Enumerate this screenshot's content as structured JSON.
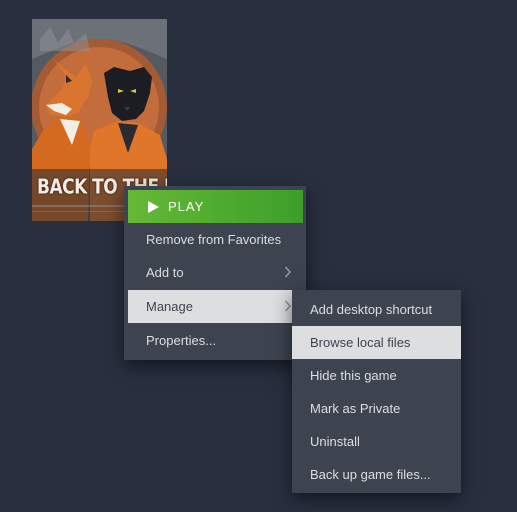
{
  "game": {
    "cover_title": "BACK TO THE DAWN",
    "cover_icon": "fox-and-panther-artwork"
  },
  "context_menu": {
    "play_label": "PLAY",
    "play_icon": "play-triangle-icon",
    "items": [
      {
        "label": "Remove from Favorites"
      },
      {
        "label": "Add to",
        "submenu": true
      },
      {
        "label": "Manage",
        "submenu": true,
        "highlighted": true
      },
      {
        "label": "Properties..."
      }
    ]
  },
  "manage_submenu": {
    "items": [
      {
        "label": "Add desktop shortcut"
      },
      {
        "label": "Browse local files",
        "highlighted": true
      },
      {
        "label": "Hide this game"
      },
      {
        "label": "Mark as Private"
      },
      {
        "label": "Uninstall"
      },
      {
        "label": "Back up game files..."
      }
    ]
  },
  "colors": {
    "background": "#283040",
    "menu_bg": "#3d4450",
    "menu_text": "#dcdedf",
    "highlight_bg": "#dcdedf",
    "play_green": "#65b935"
  }
}
